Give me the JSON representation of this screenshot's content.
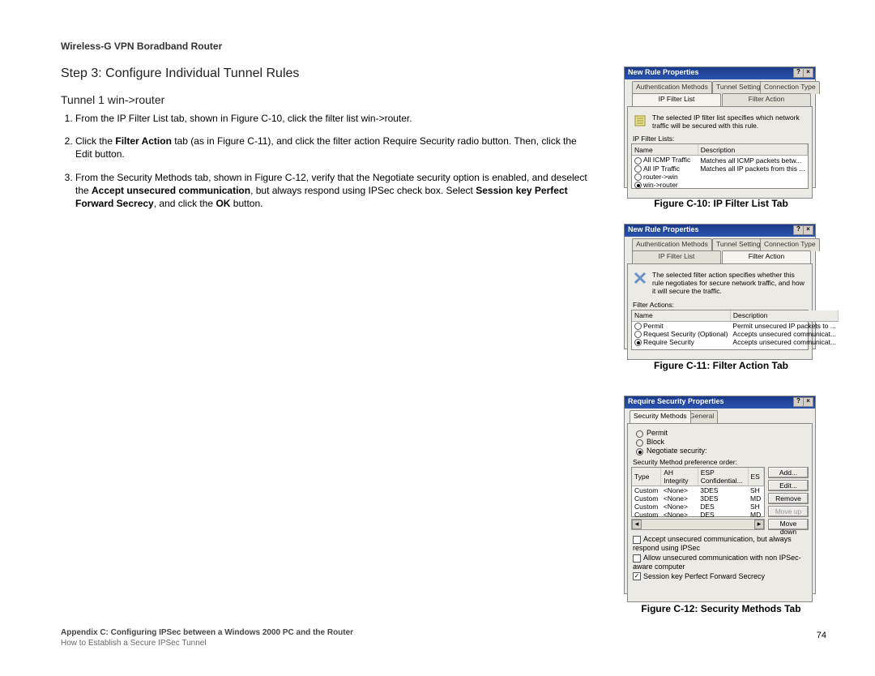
{
  "header": "Wireless-G VPN Boradband Router",
  "step_title": "Step 3: Configure Individual Tunnel Rules",
  "subtitle": "Tunnel 1 win->router",
  "instructions": {
    "i1": "From the IP Filter List tab, shown in Figure C-10, click the filter list win->router.",
    "i2_a": "Click the ",
    "i2_b": "Filter Action",
    "i2_c": " tab (as in Figure C-11), and click the filter action Require Security radio button. Then, click the Edit button.",
    "i3_a": "From the Security Methods tab, shown in Figure C-12, verify that the Negotiate security option is enabled, and deselect the ",
    "i3_b": "Accept unsecured communication",
    "i3_c": ", but always respond using IPSec check box. Select ",
    "i3_d": "Session key Perfect Forward Secrecy",
    "i3_e": ", and click the ",
    "i3_f": "OK",
    "i3_g": " button."
  },
  "footer_line1": "Appendix C: Configuring IPSec between a Windows 2000 PC and the Router",
  "footer_line2": "How to Establish a Secure IPSec Tunnel",
  "page_number": "74",
  "figC10": {
    "caption": "Figure C-10: IP Filter List Tab",
    "title": "New Rule Properties",
    "tabs": {
      "auth": "Authentication Methods",
      "tunnel": "Tunnel Setting",
      "conn": "Connection Type",
      "filterlist": "IP Filter List",
      "action": "Filter Action"
    },
    "info": "The selected IP filter list specifies which network traffic will be secured with this rule.",
    "list_label": "IP Filter Lists:",
    "cols": {
      "name": "Name",
      "desc": "Description"
    },
    "rows": [
      {
        "name": "All ICMP Traffic",
        "desc": "Matches all ICMP packets betw..."
      },
      {
        "name": "All IP Traffic",
        "desc": "Matches all IP packets from this ..."
      },
      {
        "name": "router->win",
        "desc": ""
      },
      {
        "name": "win->router",
        "desc": ""
      }
    ]
  },
  "figC11": {
    "caption": "Figure C-11: Filter Action Tab",
    "title": "New Rule Properties",
    "tabs": {
      "auth": "Authentication Methods",
      "tunnel": "Tunnel Setting",
      "conn": "Connection Type",
      "filterlist": "IP Filter List",
      "action": "Filter Action"
    },
    "info": "The selected filter action specifies whether this rule negotiates for secure network traffic, and how it will secure the traffic.",
    "list_label": "Filter Actions:",
    "cols": {
      "name": "Name",
      "desc": "Description"
    },
    "rows": [
      {
        "name": "Permit",
        "desc": "Permit unsecured IP packets to ..."
      },
      {
        "name": "Request Security (Optional)",
        "desc": "Accepts unsecured communicat..."
      },
      {
        "name": "Require Security",
        "desc": "Accepts unsecured communicat..."
      }
    ]
  },
  "figC12": {
    "caption": "Figure C-12: Security Methods Tab",
    "title": "Require Security Properties",
    "tabs": {
      "sec": "Security Methods",
      "gen": "General"
    },
    "radios": {
      "permit": "Permit",
      "block": "Block",
      "negotiate": "Negotiate security:"
    },
    "pref_label": "Security Method preference order:",
    "cols": {
      "type": "Type",
      "ah": "AH Integrity",
      "esp": "ESP Confidential...",
      "es": "ES"
    },
    "rows": [
      {
        "type": "Custom",
        "ah": "<None>",
        "esp": "3DES",
        "es": "SH"
      },
      {
        "type": "Custom",
        "ah": "<None>",
        "esp": "3DES",
        "es": "MD"
      },
      {
        "type": "Custom",
        "ah": "<None>",
        "esp": "DES",
        "es": "SH"
      },
      {
        "type": "Custom",
        "ah": "<None>",
        "esp": "DES",
        "es": "MD"
      }
    ],
    "buttons": {
      "add": "Add...",
      "edit": "Edit...",
      "remove": "Remove",
      "moveup": "Move up",
      "movedown": "Move down"
    },
    "checks": {
      "c1": "Accept unsecured communication, but always respond using IPSec",
      "c2": "Allow unsecured communication with non IPSec-aware computer",
      "c3": "Session key Perfect Forward Secrecy"
    }
  }
}
